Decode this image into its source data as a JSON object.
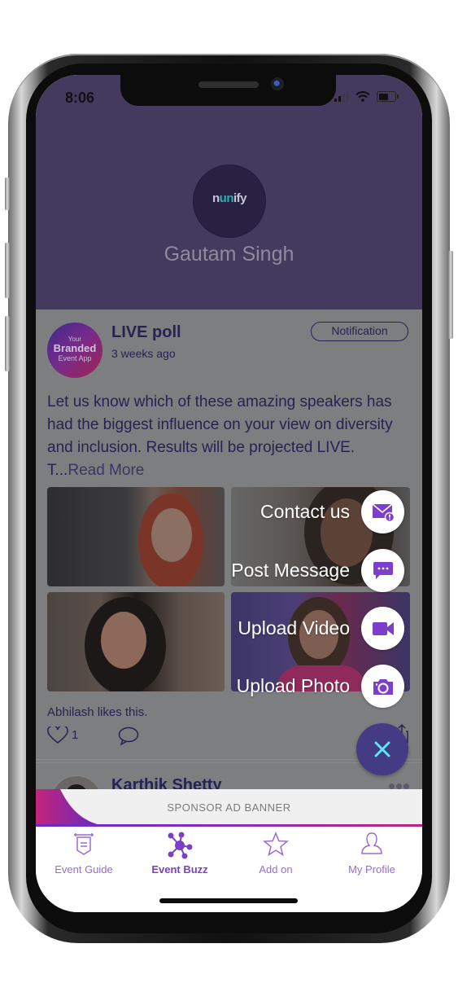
{
  "status_bar": {
    "time": "8:06"
  },
  "header": {
    "logo_text_pre": "n",
    "logo_text_accent": "un",
    "logo_text_post": "ify",
    "user_name": "Gautam Singh"
  },
  "posts": [
    {
      "avatar_lines": [
        "Your",
        "Branded",
        "Event App"
      ],
      "title": "LIVE poll",
      "time": "3 weeks ago",
      "badge": "Notification",
      "body": "Let us know which of these amazing speakers has had the biggest influence on your view on diversity and inclusion. Results will be projected LIVE. T...",
      "read_more": "Read More",
      "likes_text": "Abhilash likes this.",
      "like_count": "1"
    },
    {
      "title": "Karthik Shetty"
    }
  ],
  "fab_menu": {
    "items": [
      {
        "label": "Contact us",
        "icon": "mail-alert-icon"
      },
      {
        "label": "Post Message",
        "icon": "chat-bubble-icon"
      },
      {
        "label": "Upload Video",
        "icon": "video-camera-icon"
      },
      {
        "label": "Upload Photo",
        "icon": "camera-icon"
      }
    ],
    "close_icon": "close-icon",
    "accent": "#7b3fc9",
    "close_bg": "#433b83",
    "close_x_color": "#5ee7f2"
  },
  "ad_banner": {
    "text": "SPONSOR AD BANNER"
  },
  "tabbar": {
    "tabs": [
      {
        "label": "Event Guide",
        "icon": "signboard-icon",
        "active": false
      },
      {
        "label": "Event Buzz",
        "icon": "network-hub-icon",
        "active": true
      },
      {
        "label": "Add on",
        "icon": "star-icon",
        "active": false
      },
      {
        "label": "My Profile",
        "icon": "person-icon",
        "active": false
      }
    ],
    "active_color": "#7a3fc9",
    "inactive_color": "#9a6ad6"
  },
  "colors": {
    "header_bg": "#443a5e",
    "overlay_gray": "#7d7e80",
    "text_dark": "#262254"
  }
}
